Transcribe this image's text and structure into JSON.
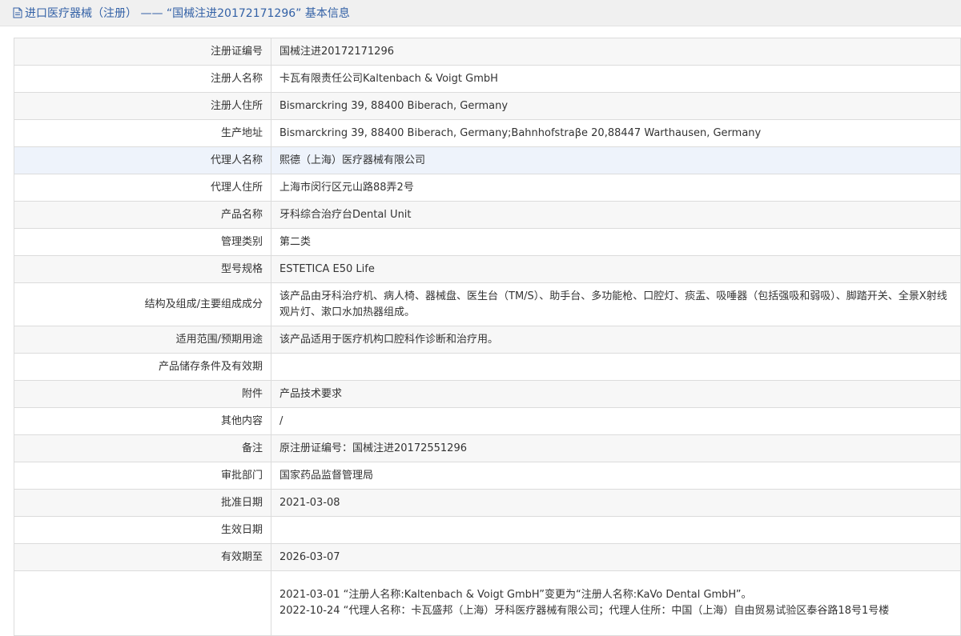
{
  "header": {
    "title": "进口医疗器械（注册） ——  “国械注进20172171296”  基本信息"
  },
  "rows": [
    {
      "label": "注册证编号",
      "value": "国械注进20172171296"
    },
    {
      "label": "注册人名称",
      "value": "卡瓦有限责任公司Kaltenbach & Voigt GmbH"
    },
    {
      "label": "注册人住所",
      "value": "Bismarckring 39, 88400 Biberach, Germany"
    },
    {
      "label": "生产地址",
      "value": "Bismarckring 39, 88400 Biberach, Germany;Bahnhofstraβe 20,88447 Warthausen, Germany"
    },
    {
      "label": "代理人名称",
      "value": "熙德（上海）医疗器械有限公司"
    },
    {
      "label": "代理人住所",
      "value": "上海市闵行区元山路88弄2号"
    },
    {
      "label": "产品名称",
      "value": "牙科综合治疗台Dental Unit"
    },
    {
      "label": "管理类别",
      "value": "第二类"
    },
    {
      "label": "型号规格",
      "value": "ESTETICA E50 Life"
    },
    {
      "label": "结构及组成/主要组成成分",
      "value": "该产品由牙科治疗机、病人椅、器械盘、医生台（TM/S）、助手台、多功能枪、口腔灯、痰盂、吸唾器（包括强吸和弱吸）、脚踏开关、全景X射线观片灯、漱口水加热器组成。"
    },
    {
      "label": "适用范围/预期用途",
      "value": "该产品适用于医疗机构口腔科作诊断和治疗用。"
    },
    {
      "label": "产品储存条件及有效期",
      "value": ""
    },
    {
      "label": "附件",
      "value": "产品技术要求"
    },
    {
      "label": "其他内容",
      "value": "/"
    },
    {
      "label": "备注",
      "value": "原注册证编号：国械注进20172551296"
    },
    {
      "label": "审批部门",
      "value": "国家药品监督管理局"
    },
    {
      "label": "批准日期",
      "value": "2021-03-08"
    },
    {
      "label": "生效日期",
      "value": ""
    },
    {
      "label": "有效期至",
      "value": "2026-03-07"
    }
  ],
  "change_notes": {
    "label": "",
    "lines": [
      "2021-03-01  “注册人名称:Kaltenbach & Voigt GmbH”变更为“注册人名称:KaVo Dental GmbH”。",
      "2022-10-24  “代理人名称：卡瓦盛邦（上海）牙科医疗器械有限公司；代理人住所：中国（上海）自由贸易试验区泰谷路18号1号楼"
    ]
  }
}
